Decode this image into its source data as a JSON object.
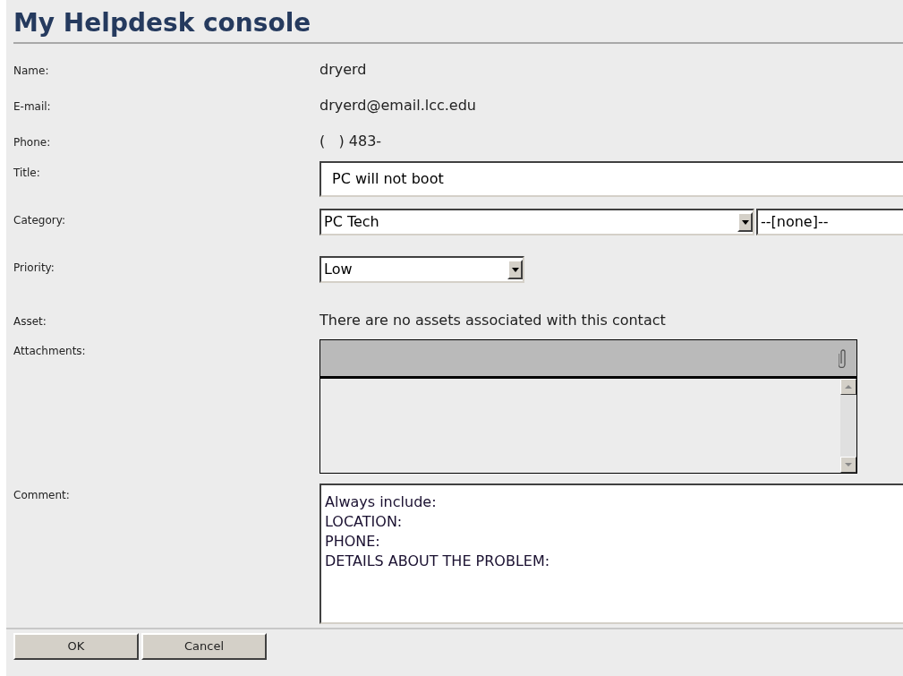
{
  "title": "My Helpdesk console",
  "fields": [
    {
      "label": "Name:",
      "kind": "text",
      "value": "dryerd"
    },
    {
      "label": "E-mail:",
      "kind": "text",
      "value": "dryerd@email.lcc.edu"
    },
    {
      "label": "Phone:",
      "kind": "text",
      "value": "(   ) 483-"
    },
    {
      "label": "Title:",
      "kind": "input",
      "value": "PC will not boot"
    },
    {
      "label": "Category:",
      "kind": "selects",
      "selects": [
        {
          "value": "PC Tech"
        },
        {
          "value": "--[none]--"
        }
      ]
    },
    {
      "label": "Priority:",
      "kind": "selects",
      "selects": [
        {
          "value": "Low"
        }
      ]
    },
    {
      "label": "Asset:",
      "kind": "text",
      "value": "There are no assets associated with this contact"
    },
    {
      "label": "Attachments:",
      "kind": "attachments"
    },
    {
      "label": "Comment:",
      "kind": "textarea",
      "lines": [
        "Always include:",
        "LOCATION:",
        "PHONE:",
        "DETAILS ABOUT THE PROBLEM:"
      ]
    }
  ],
  "buttons": [
    "OK",
    "Cancel"
  ]
}
